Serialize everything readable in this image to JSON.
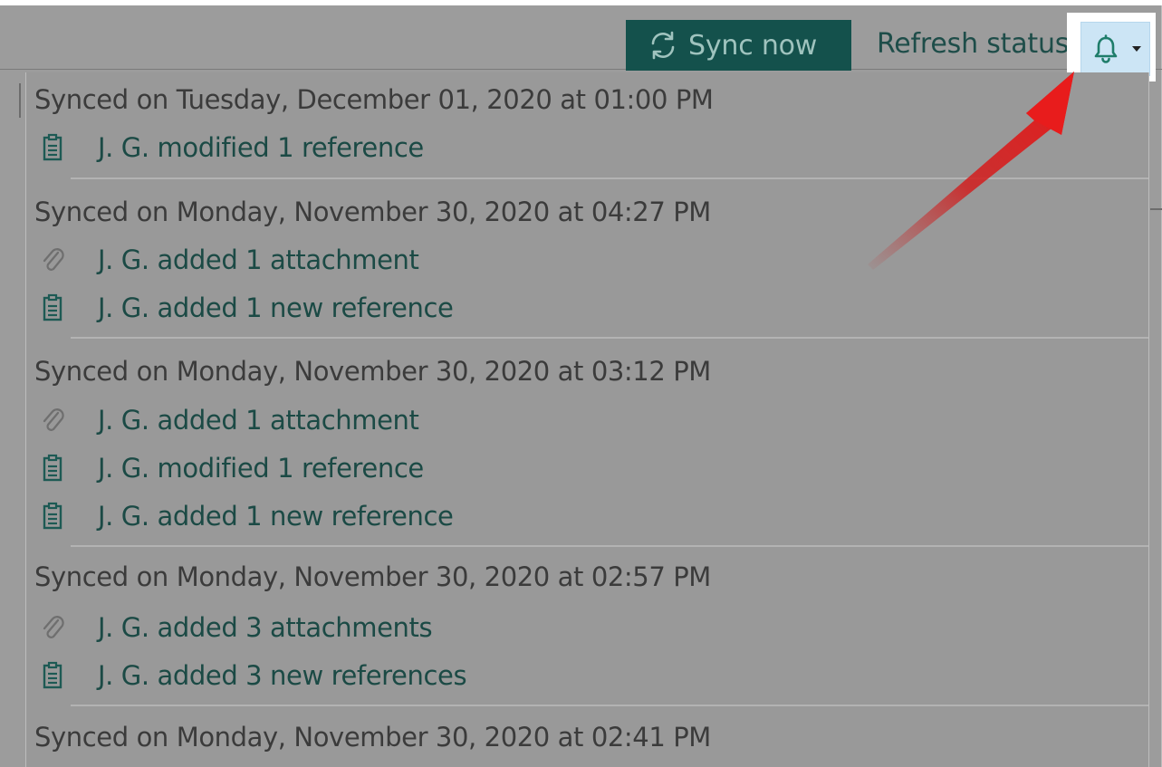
{
  "toolbar": {
    "sync_label": "Sync now",
    "refresh_label": "Refresh status",
    "sync_icon": "sync-icon",
    "bell_icon": "bell-icon",
    "caret_icon": "caret-down-icon"
  },
  "colors": {
    "accent": "#14514c",
    "link_text": "#1b4a45",
    "header_text": "#3b3b3b",
    "overlay": "#999999",
    "bell_highlight": "#cce5f5",
    "arrow": "#e01b1b"
  },
  "groups": [
    {
      "header": "Synced on Tuesday, December 01, 2020 at 01:00 PM",
      "entries": [
        {
          "icon": "clipboard-icon",
          "label": "J. G. modified 1 reference"
        }
      ]
    },
    {
      "header": "Synced on Monday, November 30, 2020 at 04:27 PM",
      "entries": [
        {
          "icon": "paperclip-icon",
          "label": "J. G. added 1 attachment"
        },
        {
          "icon": "clipboard-icon",
          "label": "J. G. added 1 new reference"
        }
      ]
    },
    {
      "header": "Synced on Monday, November 30, 2020 at 03:12 PM",
      "entries": [
        {
          "icon": "paperclip-icon",
          "label": "J. G. added 1 attachment"
        },
        {
          "icon": "clipboard-icon",
          "label": "J. G. modified 1 reference"
        },
        {
          "icon": "clipboard-icon",
          "label": "J. G. added 1 new reference"
        }
      ]
    },
    {
      "header": "Synced on Monday, November 30, 2020 at 02:57 PM",
      "entries": [
        {
          "icon": "paperclip-icon",
          "label": "J. G. added 3 attachments"
        },
        {
          "icon": "clipboard-icon",
          "label": "J. G. added 3 new references"
        }
      ]
    },
    {
      "header": "Synced on Monday, November 30, 2020 at 02:41 PM",
      "entries": []
    }
  ]
}
